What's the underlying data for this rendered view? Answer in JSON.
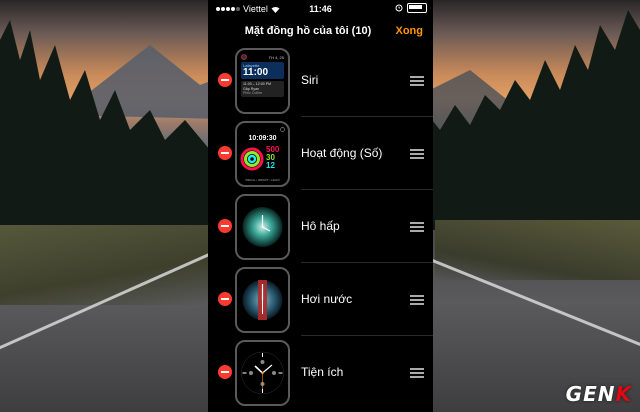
{
  "status_bar": {
    "carrier": "Viettel",
    "time": "11:46"
  },
  "nav": {
    "title": "Mặt đồng hồ của tôi (10)",
    "done": "Xong"
  },
  "faces": [
    {
      "label": "Siri",
      "preview": {
        "date": "TH 4, 25",
        "calendar": "Lafayette",
        "time": "11:00",
        "event_time": "11:00 – 12:00 PM",
        "event": "Gặp Ryan",
        "place": "Philz Coffee"
      }
    },
    {
      "label": "Hoạt động (Số)",
      "preview": {
        "time": "10:09:30",
        "move": "500",
        "exercise": "30",
        "stand": "12",
        "footer": "500CAL • 30PHÚT • 12GIỜ"
      }
    },
    {
      "label": "Hô hấp"
    },
    {
      "label": "Hơi nước"
    },
    {
      "label": "Tiện ích"
    }
  ],
  "watermark": {
    "text_a": "GEN",
    "text_b": "K"
  },
  "colors": {
    "accent": "#ff9500",
    "delete": "#ff3b30",
    "move_ring": "#fa114f",
    "exercise_ring": "#92e82a",
    "stand_ring": "#1eeaef",
    "watermark_red": "#e30613"
  }
}
